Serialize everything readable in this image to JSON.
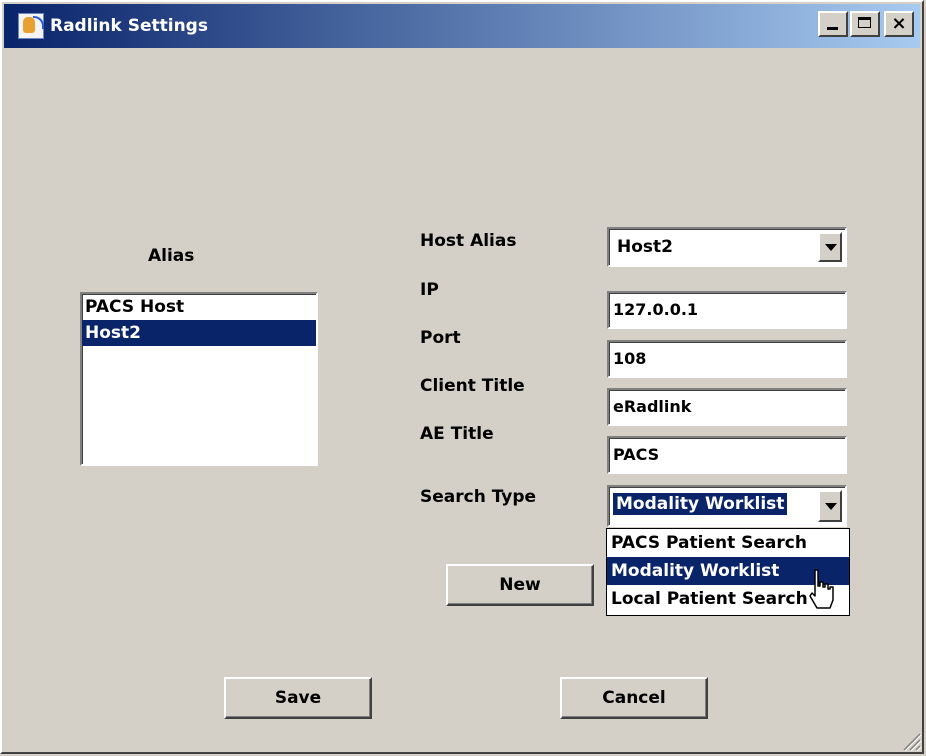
{
  "window": {
    "title": "Radlink Settings"
  },
  "alias_section": {
    "label": "Alias",
    "items": [
      "PACS Host",
      "Host2"
    ],
    "selected": "Host2"
  },
  "form": {
    "host_alias": {
      "label": "Host Alias",
      "value": "Host2"
    },
    "ip": {
      "label": "IP",
      "value": "127.0.0.1"
    },
    "port": {
      "label": "Port",
      "value": "108"
    },
    "client_title": {
      "label": "Client Title",
      "value": "eRadlink"
    },
    "ae_title": {
      "label": "AE Title",
      "value": "PACS"
    },
    "search_type": {
      "label": "Search Type",
      "value": "Modality Worklist",
      "options": [
        "PACS Patient Search",
        "Modality Worklist",
        "Local Patient Search"
      ]
    }
  },
  "buttons": {
    "new": "New",
    "save": "Save",
    "cancel": "Cancel"
  },
  "colors": {
    "face": "#d4d0c8",
    "selection": "#0a246a",
    "title_start": "#0a246a",
    "title_end": "#a6caf0"
  },
  "icons": [
    "radlink-app-icon",
    "minimize-icon",
    "maximize-icon",
    "close-icon",
    "dropdown-arrow-icon",
    "mouse-cursor-icon",
    "resize-grip-icon"
  ]
}
